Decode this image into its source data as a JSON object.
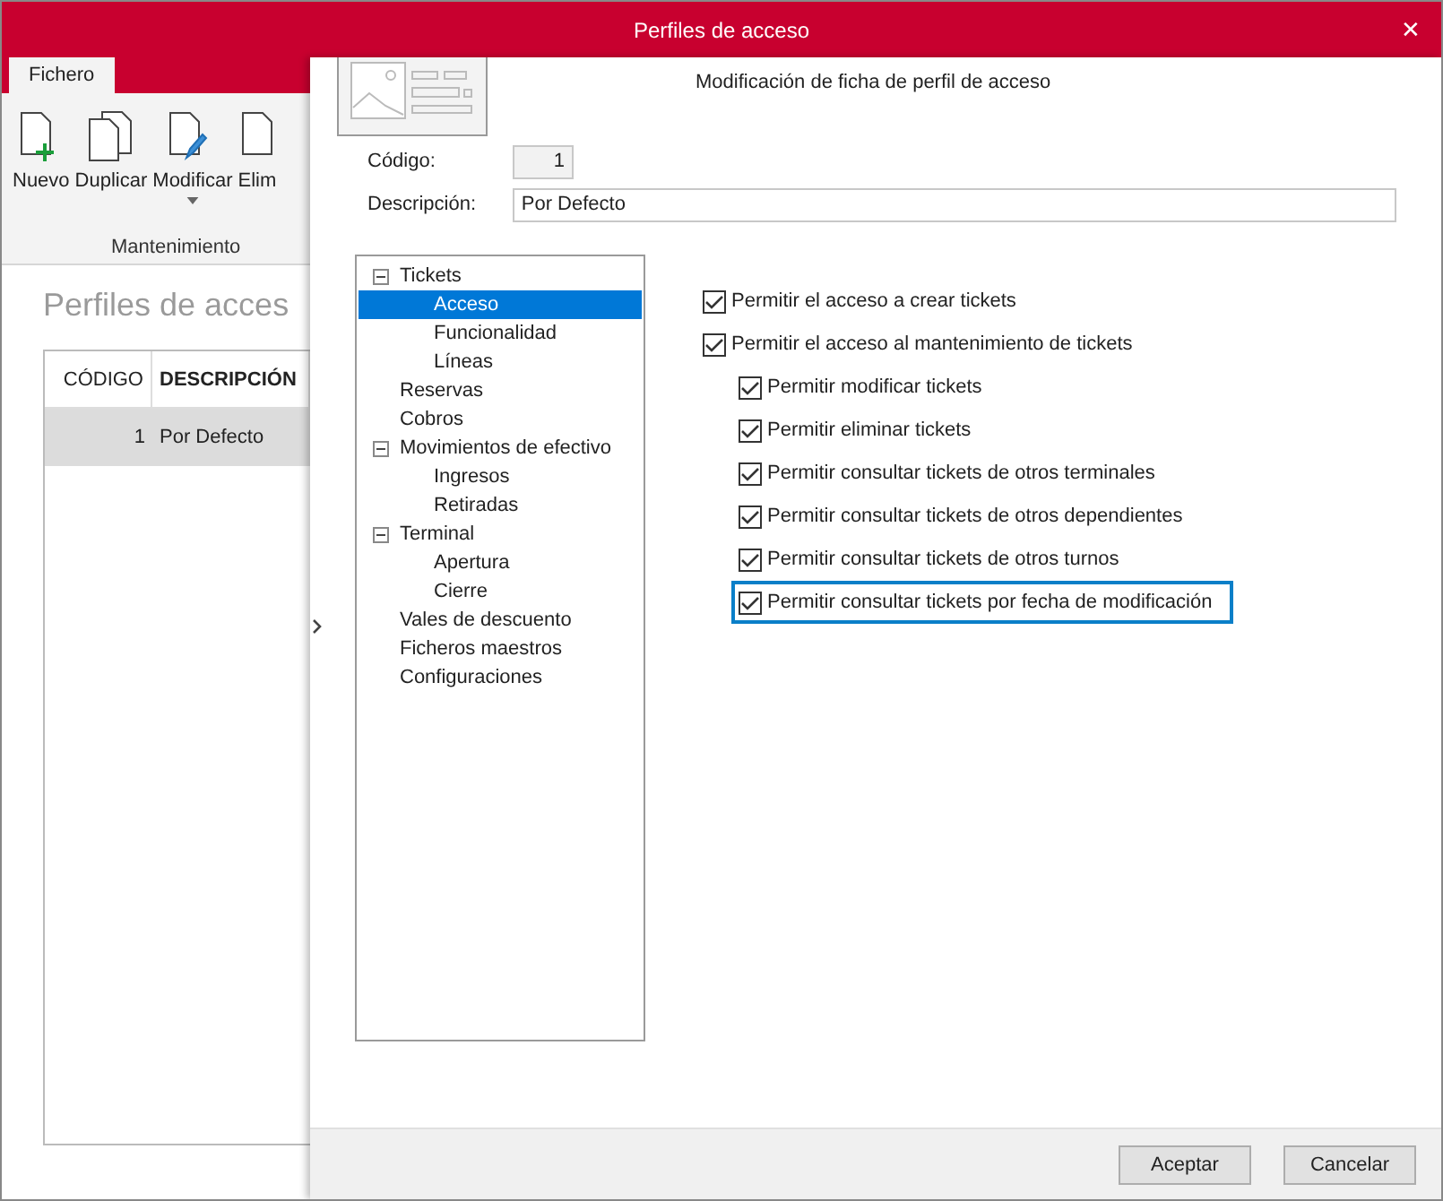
{
  "window": {
    "title": "Perfiles de acceso",
    "close": "✕"
  },
  "ribbon": {
    "tabs": [
      {
        "label": "Fichero",
        "selected": true
      }
    ],
    "buttons": [
      {
        "label": "Nuevo",
        "kind": "new"
      },
      {
        "label": "Duplicar",
        "kind": "duplicate"
      },
      {
        "label": "Modificar",
        "kind": "edit",
        "dropdown": true
      },
      {
        "label": "Elim",
        "kind": "delete"
      }
    ],
    "group": "Mantenimiento"
  },
  "list": {
    "heading": "Perfiles de acces",
    "columns": [
      "CÓDIGO",
      "DESCRIPCIÓN"
    ],
    "rows": [
      {
        "cells": [
          "1",
          "Por Defecto"
        ],
        "selected": true
      }
    ]
  },
  "dialog": {
    "title": "Modificación de ficha de perfil de acceso",
    "fields": [
      {
        "label": "Código:",
        "value": "1",
        "kind": "code"
      },
      {
        "label": "Descripción:",
        "value": "Por Defecto",
        "kind": "text"
      }
    ],
    "tree": [
      {
        "label": "Tickets",
        "expanded": true,
        "selected": false,
        "children": [
          {
            "label": "Acceso",
            "selected": true
          },
          {
            "label": "Funcionalidad",
            "selected": false
          },
          {
            "label": "Líneas",
            "selected": false
          }
        ]
      },
      {
        "label": "Reservas",
        "selected": false
      },
      {
        "label": "Cobros",
        "selected": false
      },
      {
        "label": "Movimientos de efectivo",
        "expanded": true,
        "selected": false,
        "children": [
          {
            "label": "Ingresos",
            "selected": false
          },
          {
            "label": "Retiradas",
            "selected": false
          }
        ]
      },
      {
        "label": "Terminal",
        "expanded": true,
        "selected": false,
        "children": [
          {
            "label": "Apertura",
            "selected": false
          },
          {
            "label": "Cierre",
            "selected": false
          }
        ]
      },
      {
        "label": "Vales de descuento",
        "selected": false
      },
      {
        "label": "Ficheros maestros",
        "selected": false
      },
      {
        "label": "Configuraciones",
        "selected": false
      }
    ],
    "permissions": [
      {
        "label": "Permitir el acceso a crear tickets",
        "checked": true,
        "focused": false
      },
      {
        "label": "Permitir el acceso al mantenimiento de tickets",
        "checked": true,
        "focused": false,
        "children": [
          {
            "label": "Permitir modificar tickets",
            "checked": true,
            "focused": false
          },
          {
            "label": "Permitir eliminar tickets",
            "checked": true,
            "focused": false
          },
          {
            "label": "Permitir consultar tickets de otros terminales",
            "checked": true,
            "focused": false
          },
          {
            "label": "Permitir consultar tickets de otros dependientes",
            "checked": true,
            "focused": false
          },
          {
            "label": "Permitir consultar tickets de otros turnos",
            "checked": true,
            "focused": false
          },
          {
            "label": "Permitir consultar tickets por fecha de modificación",
            "checked": true,
            "focused": true
          }
        ]
      }
    ],
    "buttons": [
      "Aceptar",
      "Cancelar"
    ]
  }
}
